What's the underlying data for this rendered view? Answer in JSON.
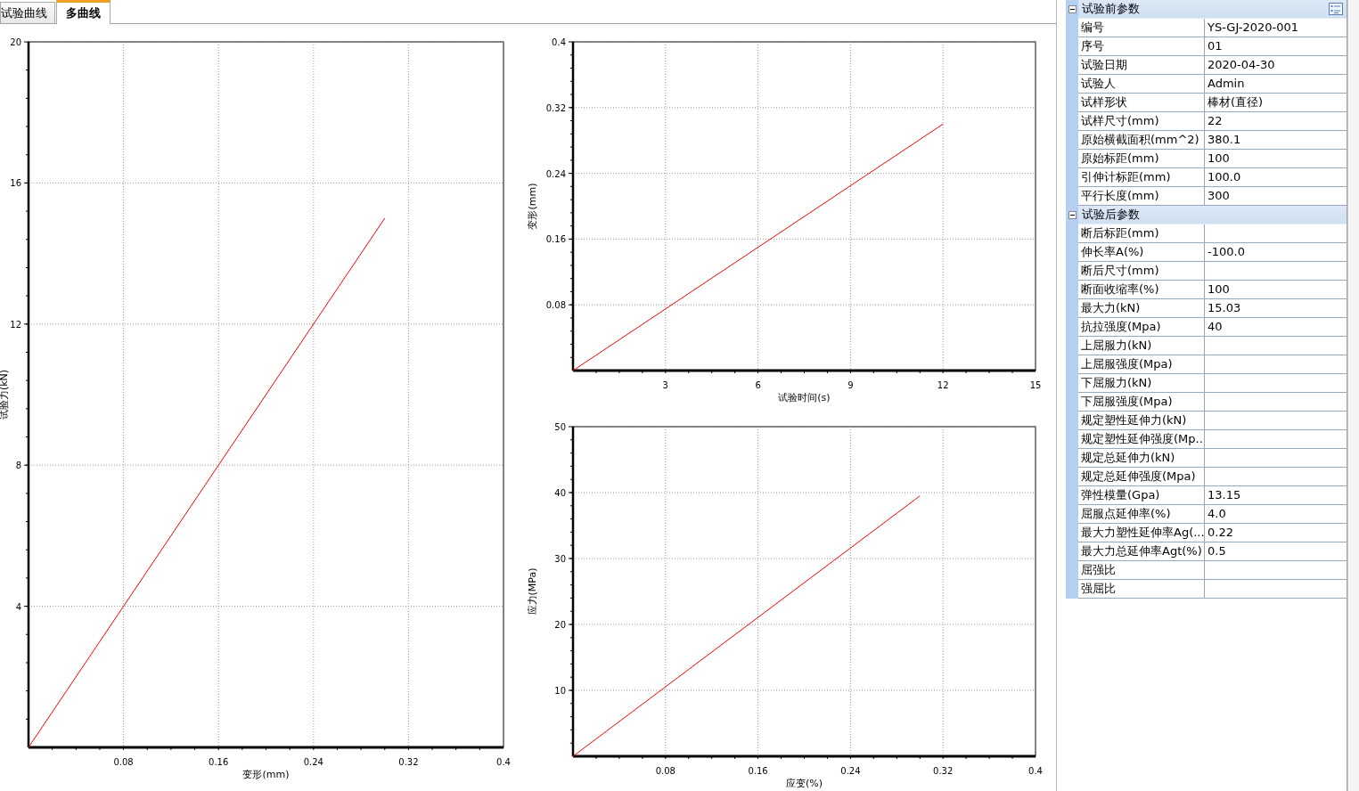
{
  "tabs": [
    {
      "label": "试验曲线",
      "selected": false
    },
    {
      "label": "多曲线",
      "selected": true
    }
  ],
  "charts": [
    {
      "chart_data": {
        "type": "line",
        "xlabel": "变形(mm)",
        "ylabel": "试验力(kN)",
        "x": [
          0,
          0.3
        ],
        "series": [
          {
            "color": "#ff0000",
            "values": [
              0,
              15
            ]
          }
        ],
        "grid": true,
        "xlim": [
          0,
          0.4
        ],
        "ylim": [
          0,
          20
        ],
        "xticks": [
          0.08,
          0.16,
          0.24,
          0.32,
          0.4
        ],
        "yticks": [
          4,
          8,
          12,
          16,
          20
        ]
      }
    },
    {
      "chart_data": {
        "type": "line",
        "xlabel": "试验时间(s)",
        "ylabel": "变形(mm)",
        "x": [
          0,
          12
        ],
        "series": [
          {
            "color": "#ff0000",
            "values": [
              0,
              0.3
            ]
          }
        ],
        "grid": true,
        "xlim": [
          0,
          15
        ],
        "ylim": [
          0,
          0.4
        ],
        "xticks": [
          3,
          6,
          9,
          12,
          15
        ],
        "yticks": [
          0.08,
          0.16,
          0.24,
          0.32,
          0.4
        ]
      }
    },
    {
      "chart_data": {
        "type": "line",
        "xlabel": "应变(%)",
        "ylabel": "应力(MPa)",
        "x": [
          0,
          0.3
        ],
        "series": [
          {
            "color": "#ff0000",
            "values": [
              0,
              39.5
            ]
          }
        ],
        "grid": true,
        "xlim": [
          0,
          0.4
        ],
        "ylim": [
          0,
          50
        ],
        "xticks": [
          0.08,
          0.16,
          0.24,
          0.32,
          0.4
        ],
        "yticks": [
          10,
          20,
          30,
          40,
          50
        ]
      }
    }
  ],
  "property_grid": {
    "sections": [
      {
        "title": "试验前参数",
        "expanded": true,
        "rows": [
          {
            "name": "编号",
            "value": "YS-GJ-2020-001"
          },
          {
            "name": "序号",
            "value": "01"
          },
          {
            "name": "试验日期",
            "value": "2020-04-30"
          },
          {
            "name": "试验人",
            "value": "Admin"
          },
          {
            "name": "试样形状",
            "value": "棒材(直径)"
          },
          {
            "name": "试样尺寸(mm)",
            "value": "22"
          },
          {
            "name": "原始横截面积(mm^2)",
            "value": "380.1"
          },
          {
            "name": "原始标距(mm)",
            "value": "100"
          },
          {
            "name": "引伸计标距(mm)",
            "value": "100.0"
          },
          {
            "name": "平行长度(mm)",
            "value": "300"
          }
        ]
      },
      {
        "title": "试验后参数",
        "expanded": true,
        "rows": [
          {
            "name": "断后标距(mm)"
          },
          {
            "name": "伸长率A(%)",
            "value": "-100.0"
          },
          {
            "name": "断后尺寸(mm)"
          },
          {
            "name": "断面收缩率(%)",
            "value": "100"
          },
          {
            "name": "最大力(kN)",
            "value": "15.03"
          },
          {
            "name": "抗拉强度(Mpa)",
            "value": "40"
          },
          {
            "name": "上屈服力(kN)"
          },
          {
            "name": "上屈服强度(Mpa)"
          },
          {
            "name": "下屈服力(kN)"
          },
          {
            "name": "下屈服强度(Mpa)"
          },
          {
            "name": "规定塑性延伸力(kN)"
          },
          {
            "name": "规定塑性延伸强度(Mp..."
          },
          {
            "name": "规定总延伸力(kN)"
          },
          {
            "name": "规定总延伸强度(Mpa)"
          },
          {
            "name": "弹性模量(Gpa)",
            "value": "13.15"
          },
          {
            "name": "屈服点延伸率(%)",
            "value": "4.0"
          },
          {
            "name": "最大力塑性延伸率Ag(...",
            "value": "0.22"
          },
          {
            "name": "最大力总延伸率Agt(%)",
            "value": "0.5"
          },
          {
            "name": "屈强比"
          },
          {
            "name": "强屈比"
          }
        ]
      }
    ]
  }
}
